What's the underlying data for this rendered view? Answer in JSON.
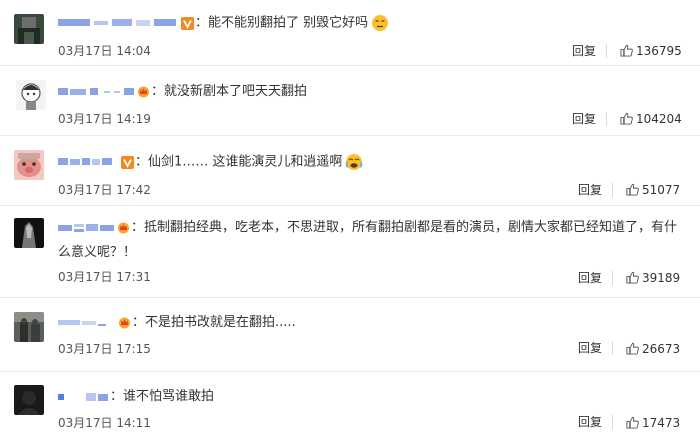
{
  "comments": [
    {
      "text": "能不能别翻拍了 别毁它好吗",
      "badge": "v-badge",
      "emoji": "tired-face-emoji",
      "time": "03月17日 14:04",
      "reply_label": "回复",
      "likes": "136795"
    },
    {
      "text": "就没新剧本了吧天天翻拍",
      "badge": "crown-badge",
      "time": "03月17日 14:19",
      "reply_label": "回复",
      "likes": "104204"
    },
    {
      "text": "仙剑1…… 这谁能演灵儿和逍遥啊",
      "badge": "v-badge",
      "emoji": "crying-face-emoji",
      "time": "03月17日 17:42",
      "reply_label": "回复",
      "likes": "51077"
    },
    {
      "text": "抵制翻拍经典，吃老本，不思进取，所有翻拍剧都是看的演员，剧情大家都已经知道了，有什",
      "text2": "么意义呢？！",
      "badge": "crown-badge",
      "time": "03月17日 17:31",
      "reply_label": "回复",
      "likes": "39189"
    },
    {
      "text": "不是拍书改就是在翻拍.....",
      "badge": "crown-badge",
      "time": "03月17日 17:15",
      "reply_label": "回复",
      "likes": "26673"
    },
    {
      "text": "谁不怕骂谁敢拍",
      "time": "03月17日 14:11",
      "reply_label": "回复",
      "likes": "17473"
    }
  ],
  "colors": {
    "text": "#333333",
    "time": "#555555",
    "divider": "#eaeaea",
    "v_badge": "#f28b1f",
    "crown": "#f5a623",
    "blurred_name": "#8aa3e6"
  },
  "icons": {
    "like": "thumbs-up-icon"
  }
}
